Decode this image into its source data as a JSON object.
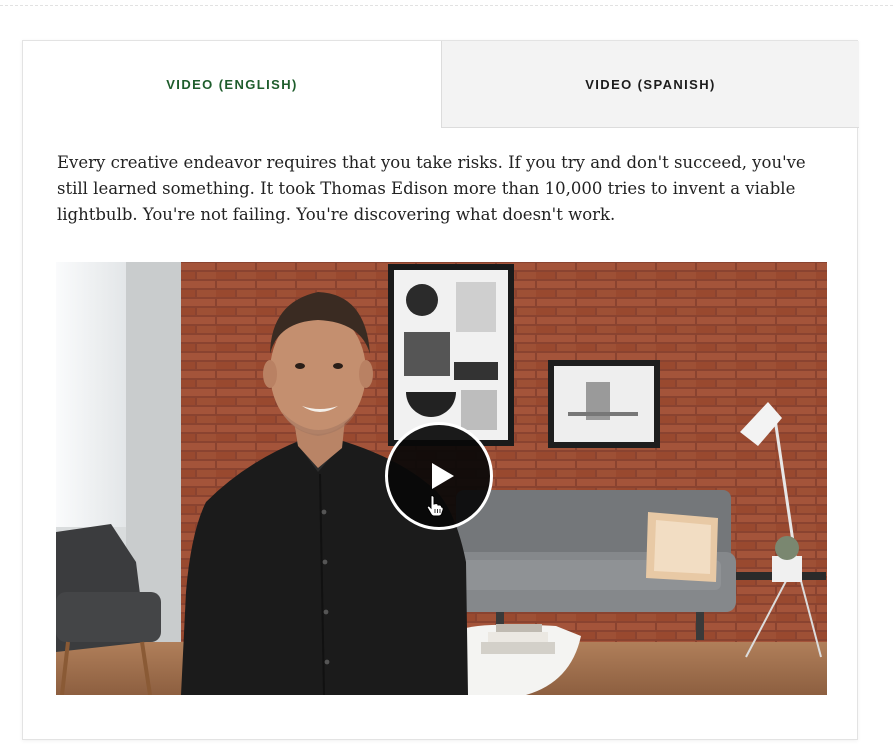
{
  "tabs": [
    {
      "label": "VIDEO (ENGLISH)",
      "active": true
    },
    {
      "label": "VIDEO (SPANISH)",
      "active": false
    }
  ],
  "content": {
    "quote": "Every creative endeavor requires that you take risks. If you try and don't succeed, you've still learned something. It took Thomas Edison more than 10,000 tries to invent a viable lightbulb. You're not failing. You're discovering what doesn't work."
  },
  "video": {
    "play_icon": "play-icon",
    "cursor_icon": "hand-pointer-icon"
  },
  "colors": {
    "active_tab_text": "#1e5d2c",
    "inactive_tab_bg": "#f3f3f3",
    "play_button_bg": "#080808"
  }
}
